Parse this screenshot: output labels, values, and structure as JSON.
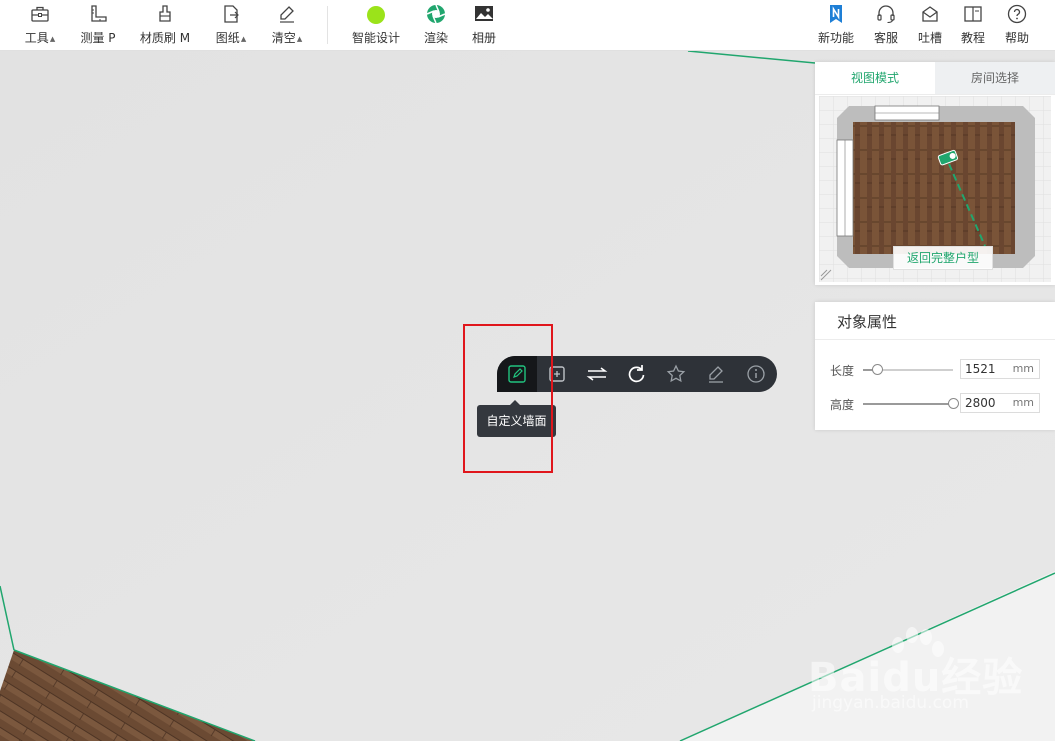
{
  "toolbar": {
    "items": [
      {
        "label": "工具",
        "icon": "toolbox-icon",
        "caret": "▲"
      },
      {
        "label": "测量 P",
        "icon": "ruler-icon"
      },
      {
        "label": "材质刷 M",
        "icon": "brush-icon"
      },
      {
        "label": "图纸",
        "icon": "drawing-icon",
        "caret": "▲"
      },
      {
        "label": "清空",
        "icon": "eraser-icon",
        "caret": "▲"
      },
      {
        "label": "智能设计",
        "icon": "smart-design-icon"
      },
      {
        "label": "渲染",
        "icon": "render-icon"
      },
      {
        "label": "相册",
        "icon": "album-icon"
      }
    ],
    "right_items": [
      {
        "label": "新功能",
        "icon": "new-feature-icon"
      },
      {
        "label": "客服",
        "icon": "headset-icon"
      },
      {
        "label": "吐槽",
        "icon": "feedback-icon"
      },
      {
        "label": "教程",
        "icon": "book-icon"
      },
      {
        "label": "帮助",
        "icon": "help-icon"
      }
    ],
    "accent_green": "#21a66e",
    "smart_design_color": "#9be31a"
  },
  "view_panel": {
    "tabs": [
      "视图模式",
      "房间选择"
    ],
    "active_tab": "视图模式",
    "return_button": "返回完整户型"
  },
  "properties": {
    "title": "对象属性",
    "rows": [
      {
        "label": "长度",
        "value": "1521",
        "unit": "mm",
        "level": 0.15
      },
      {
        "label": "高度",
        "value": "2800",
        "unit": "mm",
        "level": 1.0
      }
    ]
  },
  "context_toolbar": {
    "buttons": [
      "custom-wall-icon",
      "add-box-icon",
      "swap-icon",
      "rotate-icon",
      "favorite-icon",
      "edit-icon",
      "info-icon"
    ],
    "active": "custom-wall-icon",
    "tooltip": "自定义墙面"
  },
  "watermark": {
    "brand": "Baidu经验",
    "url": "jingyan.baidu.com"
  }
}
